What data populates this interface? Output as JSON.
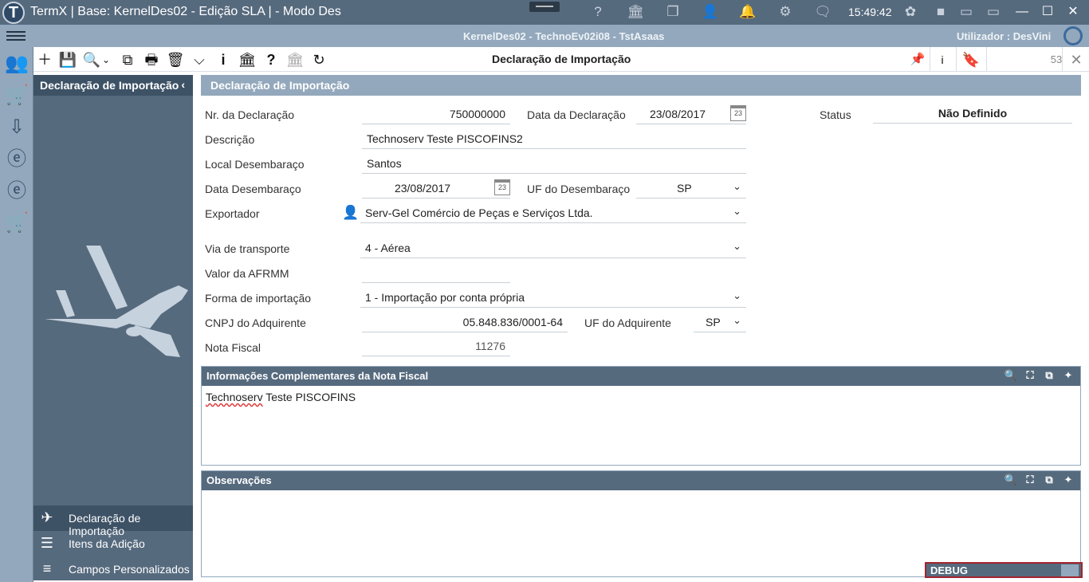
{
  "titlebar": {
    "title": "TermX | Base: KernelDes02 - Edição SLA | - Modo Des",
    "clock": "15:49:42"
  },
  "header2": {
    "context": "KernelDes02 - TechnoEv02i08 - TstAsaas",
    "user": "Utilizador : DesVini"
  },
  "toolbar": {
    "form_title": "Declaração de Importação",
    "record_count": "53"
  },
  "sidenav": {
    "title": "Declaração de Importação",
    "items": [
      {
        "label": "Declaração de Importação"
      },
      {
        "label": "Itens da Adição"
      },
      {
        "label": "Campos Personalizados"
      }
    ]
  },
  "form": {
    "section_title": "Declaração de Importação",
    "nr_declaracao_label": "Nr. da Declaração",
    "nr_declaracao": "750000000",
    "data_declaracao_label": "Data da Declaração",
    "data_declaracao": "23/08/2017",
    "status_label": "Status",
    "status": "Não Definido",
    "descricao_label": "Descrição",
    "descricao": "Technoserv Teste PISCOFINS2",
    "local_label": "Local Desembaraço",
    "local": "Santos",
    "data_desembaraco_label": "Data Desembaraço",
    "data_desembaraco": "23/08/2017",
    "uf_desembaraco_label": "UF do Desembaraço",
    "uf_desembaraco": "SP",
    "exportador_label": "Exportador",
    "exportador": "Serv-Gel Comércio de Peças e Serviços Ltda.",
    "via_label": "Via de transporte",
    "via": "4 - Aérea",
    "afrmm_label": "Valor da AFRMM",
    "afrmm": "",
    "forma_label": "Forma de importação",
    "forma": "1 - Importação por conta própria",
    "cnpj_label": "CNPJ do Adquirente",
    "cnpj": "05.848.836/0001-64",
    "uf_adquirente_label": "UF do Adquirente",
    "uf_adquirente": "SP",
    "nota_label": "Nota Fiscal",
    "nota": "11276",
    "calendar_day": "23"
  },
  "panels": {
    "info_title": "Informações Complementares da Nota Fiscal",
    "info_text_word1": "Technoserv",
    "info_text_rest": " Teste PISCOFINS",
    "obs_title": "Observações"
  },
  "debug": {
    "label": "DEBUG"
  },
  "colors": {
    "dark": "#566a7e",
    "mid": "#93a8bc",
    "darker": "#3e5266",
    "accent_green": "#1a8a3a",
    "debug_border": "#a3242e"
  }
}
